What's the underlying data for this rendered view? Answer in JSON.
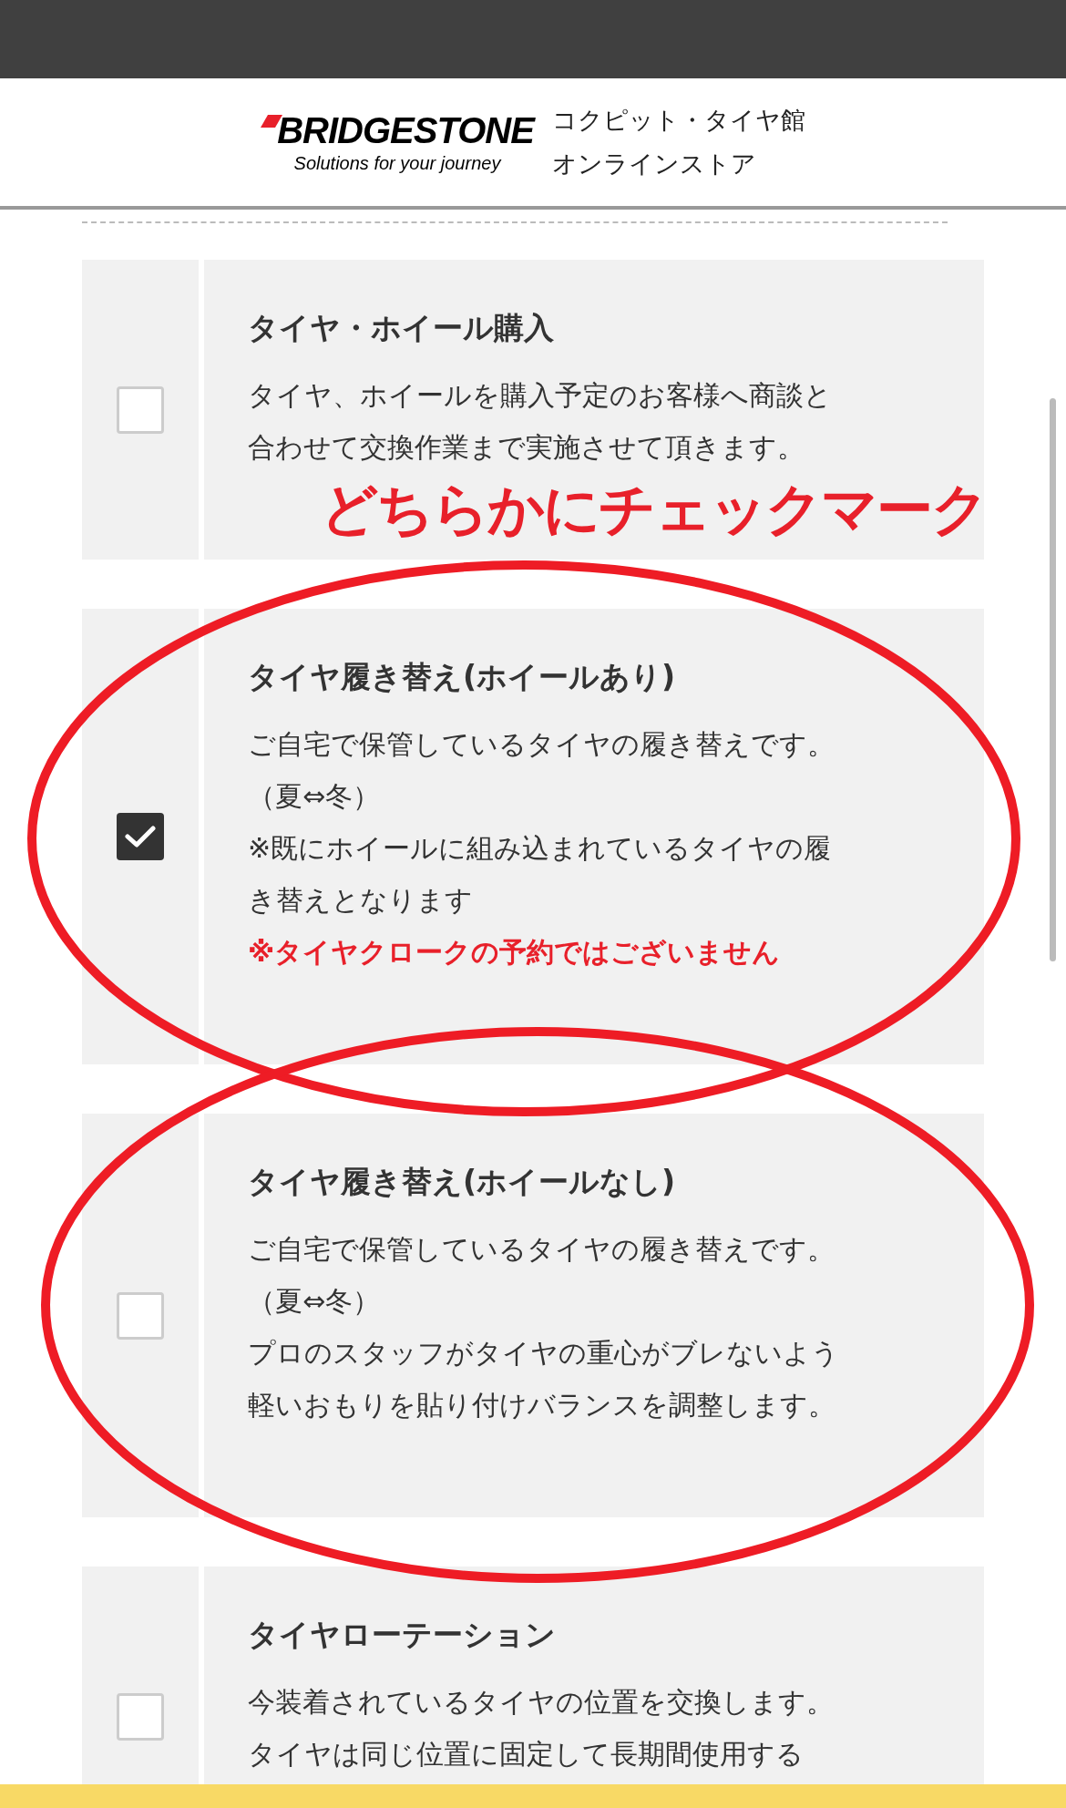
{
  "header": {
    "logo": "BRIDGESTONE",
    "tagline": "Solutions for your journey",
    "store_lines": [
      "コクピット・タイヤ館",
      "オンラインストア"
    ]
  },
  "annotation": {
    "text": "どちらかにチェックマーク"
  },
  "options": [
    {
      "title": "タイヤ・ホイール購入",
      "checked": false,
      "circled": false,
      "lines": [
        {
          "kind": "text",
          "text": "タイヤ、ホイールを購入予定のお客様へ商談と"
        },
        {
          "kind": "text",
          "text": "合わせて交換作業まで実施させて頂きます。"
        }
      ]
    },
    {
      "title": "タイヤ履き替え(ホイールあり)",
      "checked": true,
      "circled": true,
      "lines": [
        {
          "kind": "text",
          "text": "ご自宅で保管しているタイヤの履き替えです。"
        },
        {
          "kind": "text",
          "text": "（夏⇔冬）"
        },
        {
          "kind": "text",
          "text": "※既にホイールに組み込まれているタイヤの履"
        },
        {
          "kind": "text",
          "text": "き替えとなります"
        },
        {
          "kind": "note",
          "text": "※タイヤクロークの予約ではございません"
        }
      ]
    },
    {
      "title": "タイヤ履き替え(ホイールなし)",
      "checked": false,
      "circled": true,
      "lines": [
        {
          "kind": "text",
          "text": "ご自宅で保管しているタイヤの履き替えです。"
        },
        {
          "kind": "text",
          "text": "（夏⇔冬）"
        },
        {
          "kind": "text",
          "text": "プロのスタッフがタイヤの重心がブレないよう"
        },
        {
          "kind": "text",
          "text": "軽いおもりを貼り付けバランスを調整します。"
        }
      ]
    },
    {
      "title": "タイヤローテーション",
      "checked": false,
      "circled": false,
      "lines": [
        {
          "kind": "text",
          "text": "今装着されているタイヤの位置を交換します。"
        },
        {
          "kind": "text",
          "text": "タイヤは同じ位置に固定して長期間使用する"
        }
      ]
    }
  ]
}
